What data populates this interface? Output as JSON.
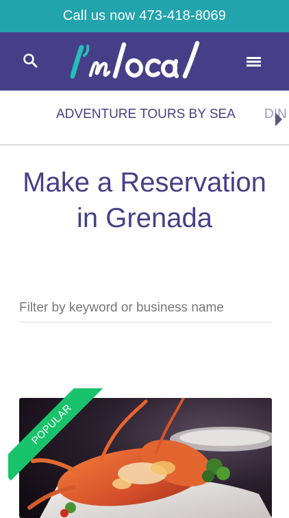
{
  "call_bar": {
    "text": "Call us now 473-418-8069"
  },
  "header": {
    "search_icon": "search-icon",
    "logo_alt": "I'm local",
    "menu_icon": "hamburger-menu-icon",
    "background": "#463f87"
  },
  "category_nav": {
    "items": [
      {
        "label": "ADVENTURE TOURS BY SEA"
      },
      {
        "label": "DIN"
      }
    ],
    "arrow_icon": "chevron-right-icon"
  },
  "page": {
    "title": "Make a Reservation in Grenada"
  },
  "filter": {
    "placeholder": "Filter by keyword or business name",
    "value": ""
  },
  "listings": [
    {
      "badge": "POPULAR",
      "image": "grilled-lobster-photo"
    }
  ],
  "colors": {
    "teal": "#22a4ad",
    "purple": "#463f87",
    "ribbon_green": "#19c36b"
  }
}
